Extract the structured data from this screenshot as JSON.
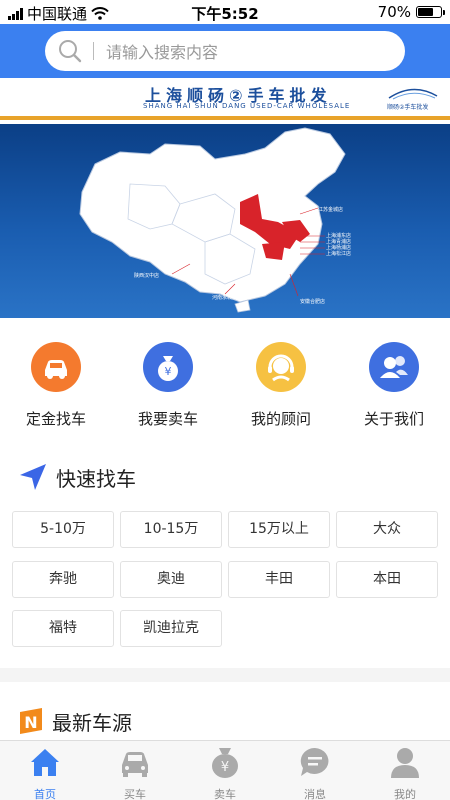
{
  "status_bar": {
    "carrier": "中国联通",
    "time": "下午5:52",
    "battery": "70%",
    "battery_level": 0.7
  },
  "search": {
    "placeholder": "请输入搜索内容"
  },
  "brand": {
    "title": "上海顺砀②手车批发",
    "subtitle": "SHANG HAI SHUN DANG USED-CAR WHOLESALE",
    "logo_small_text": "顺砀②手车批发"
  },
  "map": {
    "labels": [
      "江苏金城店",
      "上海浦东店",
      "上海青浦店",
      "上海杨浦店",
      "上海松江店",
      "陕西汉中店",
      "河南永城店",
      "安徽合肥店"
    ]
  },
  "quick_actions": [
    {
      "label": "定金找车",
      "icon": "car-icon",
      "color": "#f47a2e"
    },
    {
      "label": "我要卖车",
      "icon": "money-bag-icon",
      "color": "#3f6fe0"
    },
    {
      "label": "我的顾问",
      "icon": "headset-icon",
      "color": "#f6c142"
    },
    {
      "label": "关于我们",
      "icon": "people-icon",
      "color": "#3f6fe0"
    }
  ],
  "quick_find": {
    "title": "快速找车",
    "tags": [
      "5-10万",
      "10-15万",
      "15万以上",
      "大众",
      "奔驰",
      "奥迪",
      "丰田",
      "本田",
      "福特",
      "凯迪拉克"
    ]
  },
  "latest": {
    "title": "最新车源",
    "badge": "N"
  },
  "tabs": [
    {
      "label": "首页",
      "icon": "home-icon",
      "active": true
    },
    {
      "label": "买车",
      "icon": "car-icon",
      "active": false
    },
    {
      "label": "卖车",
      "icon": "money-bag-icon",
      "active": false
    },
    {
      "label": "消息",
      "icon": "message-icon",
      "active": false
    },
    {
      "label": "我的",
      "icon": "user-icon",
      "active": false
    }
  ]
}
